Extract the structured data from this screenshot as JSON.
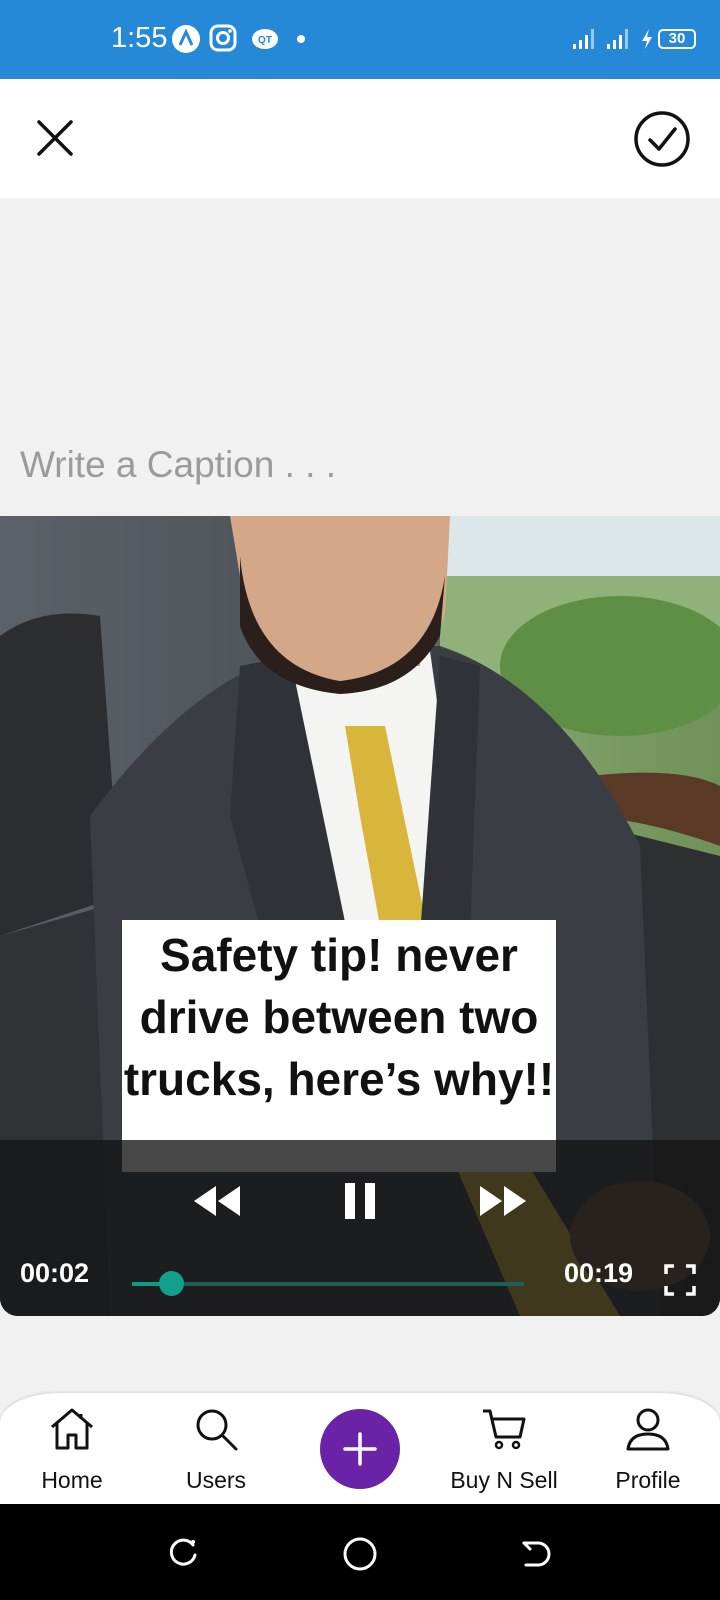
{
  "status_bar": {
    "time": "1:55",
    "battery": "30",
    "bg_color": "#2589d8"
  },
  "caption": {
    "placeholder": "Write a Caption . . ."
  },
  "video": {
    "overlay_text": "Safety tip! never drive between two trucks, here’s why!!",
    "current_time": "00:02",
    "duration": "00:19",
    "progress": 0.1,
    "accent_color": "#12a08c"
  },
  "bottom_nav": {
    "items": [
      {
        "label": "Home",
        "icon": "home-icon"
      },
      {
        "label": "Users",
        "icon": "search-icon"
      },
      {
        "label": "Buy N Sell",
        "icon": "cart-icon"
      },
      {
        "label": "Profile",
        "icon": "person-icon"
      }
    ],
    "fab_color": "#6a23a6"
  }
}
